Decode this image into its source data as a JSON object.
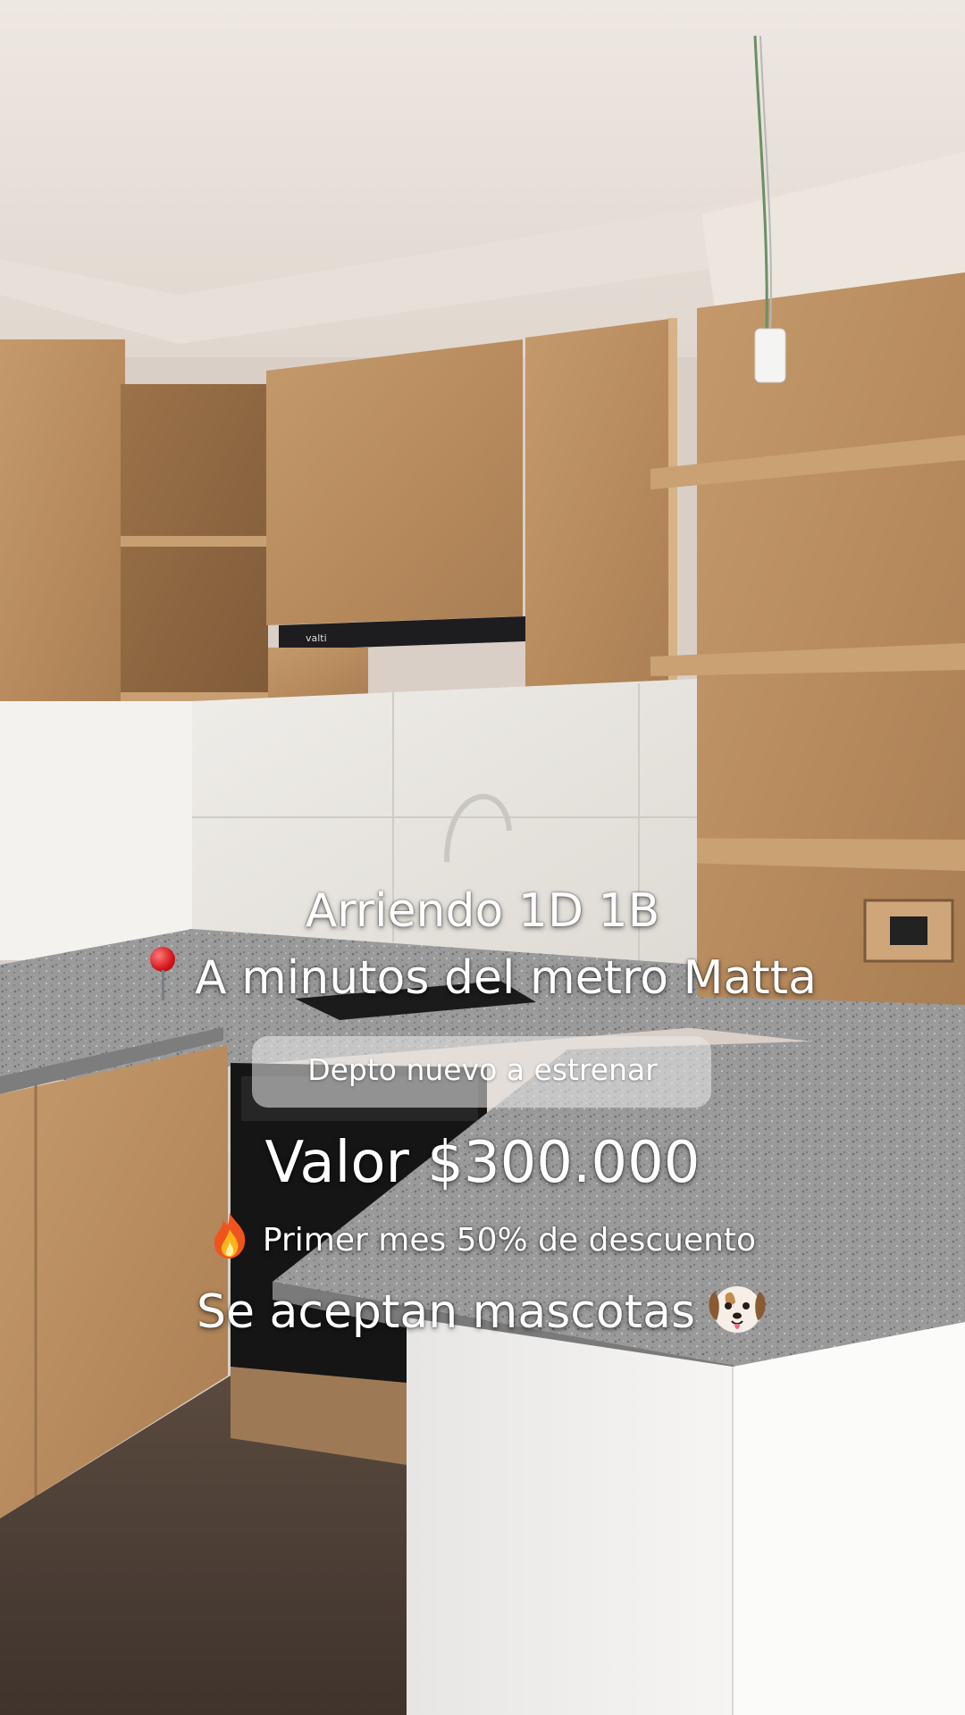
{
  "post": {
    "line1": "Arriendo 1D 1B",
    "line2": "A minutos del metro Matta",
    "line2_icon": "round-pushpin-icon",
    "highlight": "Depto nuevo a estrenar",
    "price": "Valor $300.000",
    "promo": "Primer mes 50% de descuento",
    "promo_icon": "fire-icon",
    "pets": "Se aceptan mascotas",
    "pets_icon": "dog-face-icon"
  },
  "photo": {
    "hood_brand": "valti"
  }
}
